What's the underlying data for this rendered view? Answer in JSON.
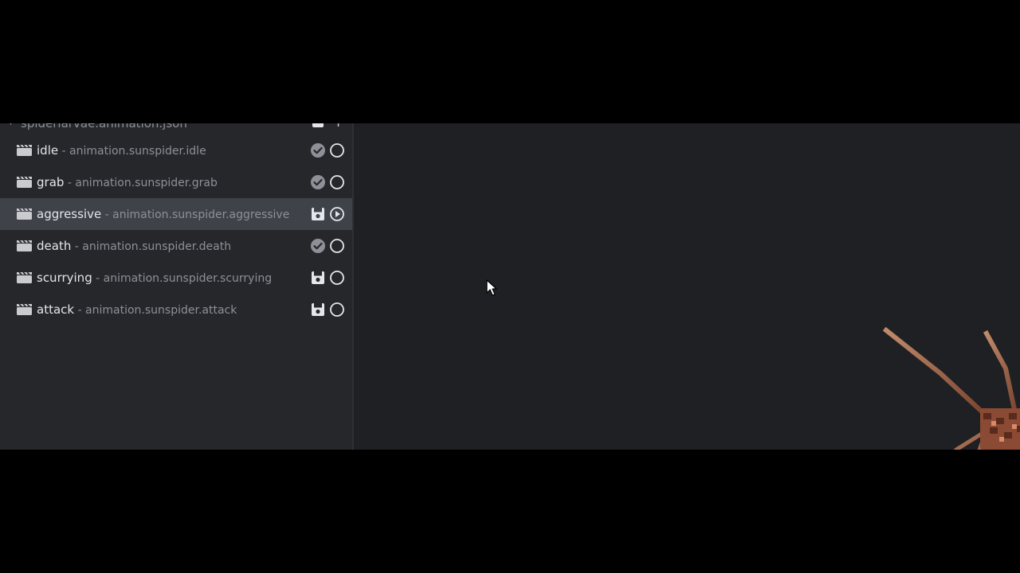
{
  "outliner": {
    "file": {
      "name": "spiderlarvae.animation.json"
    },
    "animations": [
      {
        "name": "idle",
        "separator": " - ",
        "id": "animation.sunspider.idle",
        "status": "check",
        "selected": false
      },
      {
        "name": "grab",
        "separator": " - ",
        "id": "animation.sunspider.grab",
        "status": "check",
        "selected": false
      },
      {
        "name": "aggressive",
        "separator": " - ",
        "id": "animation.sunspider.aggressive",
        "status": "save",
        "selected": true
      },
      {
        "name": "death",
        "separator": " - ",
        "id": "animation.sunspider.death",
        "status": "check",
        "selected": false
      },
      {
        "name": "scurrying",
        "separator": " - ",
        "id": "animation.sunspider.scurrying",
        "status": "save",
        "selected": false
      },
      {
        "name": "attack",
        "separator": " - ",
        "id": "animation.sunspider.attack",
        "status": "save",
        "selected": false
      }
    ]
  },
  "icons": {
    "clapperboard": "clapperboard-icon",
    "check": "check-circle-icon",
    "save": "save-icon",
    "play": "play-circle-icon",
    "circle": "empty-circle-icon",
    "add": "plus-icon",
    "collapse": "chevron-down-icon",
    "cursor": "mouse-pointer-icon"
  },
  "colors": {
    "panel": "#25272b",
    "viewport": "#1f2023",
    "selected_row": "#3f4249",
    "text_primary": "#e4e6ea",
    "text_secondary": "#8d9096",
    "model_body": "#a8684a"
  }
}
